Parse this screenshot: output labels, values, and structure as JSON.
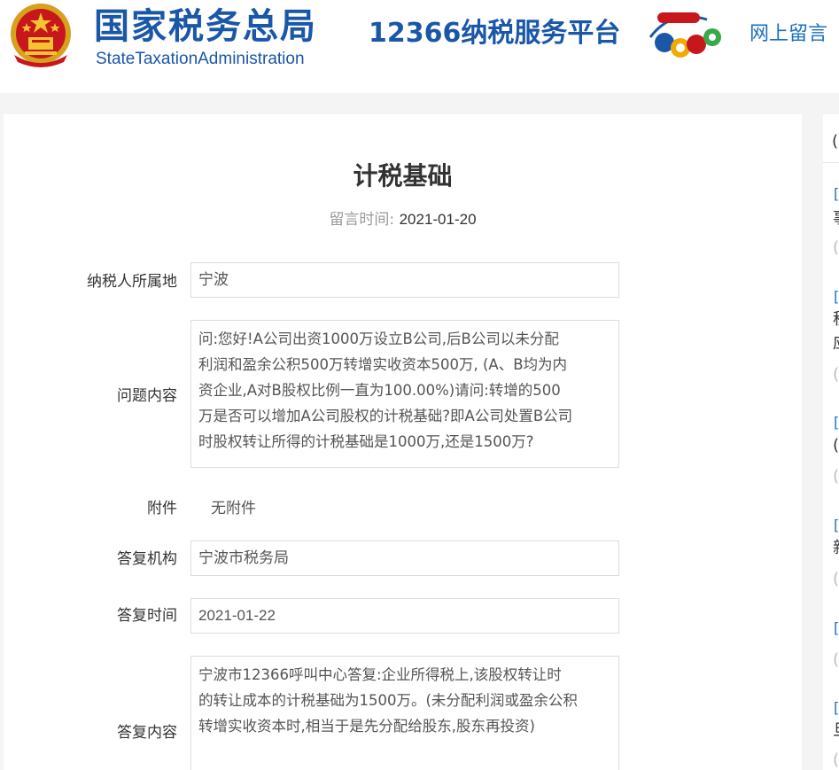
{
  "header": {
    "brand_cn": "国家税务总局",
    "brand_en": "StateTaxationAdministration",
    "platform": "12366纳税服务平台",
    "nav_link": "网上留言"
  },
  "main": {
    "title": "计税基础",
    "message_time_label": "留言时间:",
    "message_time": "2021-01-20",
    "fields": {
      "location_label": "纳税人所属地",
      "location_value": "宁波",
      "question_label": "问题内容",
      "question_lines": [
        "问:您好!A公司出资1000万设立B公司,后B公司以未分配",
        "利润和盈余公积500万转增实收资本500万, (A、B均为内",
        "资企业,A对B股权比例一直为100.00%)请问:转增的500",
        "万是否可以增加A公司股权的计税基础?即A公司处置B公司",
        "时股权转让所得的计税基础是1000万,还是1500万?"
      ],
      "attachment_label": "附件",
      "attachment_value": "无附件",
      "agency_label": "答复机构",
      "agency_value": "宁波市税务局",
      "reply_time_label": "答复时间",
      "reply_time_value": "2021-01-22",
      "reply_label": "答复内容",
      "reply_lines": [
        "宁波市12366呼叫中心答复:企业所得税上,该股权转让时",
        "的转让成本的计税基础为1500万。(未分配利润或盈余公积",
        "转增实收资本时,相当于是先分配给股东,股东再投资)"
      ]
    }
  },
  "sidebar": {
    "heading_fragment": "(",
    "bracket": "[",
    "fragments": [
      "事",
      "税",
      "应",
      "(",
      "新",
      "旦"
    ],
    "faded": "(",
    "colors": {
      "link": "#1a6fbf"
    }
  },
  "colors": {
    "brand_blue": "#1a57a8",
    "link_blue": "#1a6fbf",
    "page_bg": "#f4f4f4",
    "border": "#dcdcdc"
  }
}
